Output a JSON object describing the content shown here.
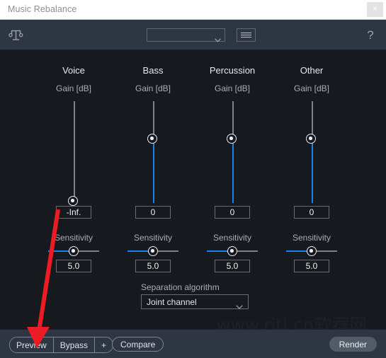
{
  "window": {
    "title": "Music Rebalance",
    "close_label": "×"
  },
  "toolbar": {
    "brand_icon": "balance-music-icon",
    "preset_value": "",
    "preset_placeholder": "",
    "menu_icon": "hamburger-menu-icon",
    "help_label": "?"
  },
  "columns": [
    {
      "name": "Voice",
      "gain_label": "Gain [dB]",
      "gain_value": "-Inf.",
      "gain_handle_pct": 94,
      "sensitivity_label": "Sensitivity",
      "sensitivity_value": "5.0",
      "sensitivity_pct": 50
    },
    {
      "name": "Bass",
      "gain_label": "Gain [dB]",
      "gain_value": "0",
      "gain_handle_pct": 36,
      "sensitivity_label": "Sensitivity",
      "sensitivity_value": "5.0",
      "sensitivity_pct": 50
    },
    {
      "name": "Percussion",
      "gain_label": "Gain [dB]",
      "gain_value": "0",
      "gain_handle_pct": 36,
      "sensitivity_label": "Sensitivity",
      "sensitivity_value": "5.0",
      "sensitivity_pct": 50
    },
    {
      "name": "Other",
      "gain_label": "Gain [dB]",
      "gain_value": "0",
      "gain_handle_pct": 36,
      "sensitivity_label": "Sensitivity",
      "sensitivity_value": "5.0",
      "sensitivity_pct": 50
    }
  ],
  "separation": {
    "label": "Separation algorithm",
    "value": "Joint channel"
  },
  "footer": {
    "preview_label": "Preview",
    "bypass_label": "Bypass",
    "add_label": "+",
    "compare_label": "Compare",
    "render_label": "Render"
  },
  "watermark": {
    "text": "www.rjtj.cn软荐网"
  },
  "annotation": {
    "arrow_color": "#ed1c24",
    "arrow_target": "preview-button"
  },
  "colors": {
    "accent_blue": "#1f7feb",
    "panel_bg": "#16191d",
    "chrome_bg": "#2e3643",
    "titlebar_bg": "#ffffff"
  }
}
